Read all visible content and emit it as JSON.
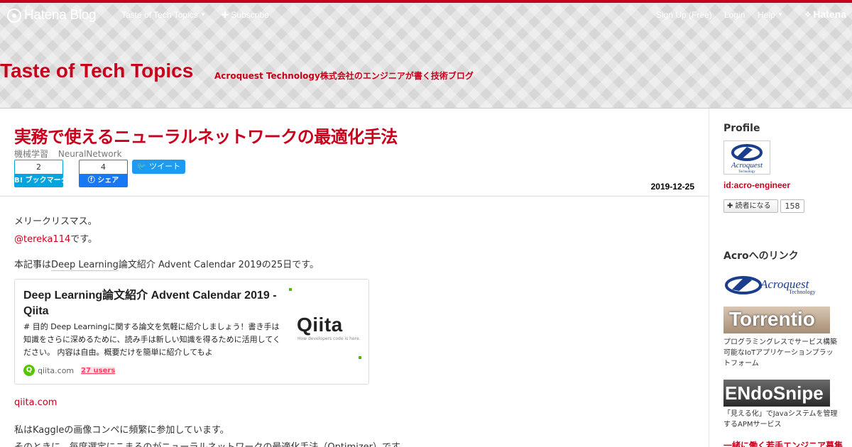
{
  "globalbar": {
    "logo_text": "Hatena Blog",
    "blog_menu": "Taste of Tech Topics",
    "subscribe": "Subscribe",
    "signup": "Sign Up (Free)",
    "login": "Login",
    "help": "Help",
    "brand": "Hatena"
  },
  "blog": {
    "title": "Taste of Tech Topics",
    "description": "Acroquest Technology株式会社のエンジニアが書く技術ブログ"
  },
  "entry": {
    "title": "実務で使えるニューラルネットワークの最適化手法",
    "categories": [
      "機械学習",
      "NeuralNetwork"
    ],
    "bookmark_count": "2",
    "bookmark_label": "ブックマーク",
    "facebook_count": "4",
    "facebook_label": "シェア",
    "tweet_label": "ツイート",
    "date": "2019-12-25",
    "lines": {
      "greeting": "メリークリスマス。",
      "author_link": "@tereka114",
      "author_suffix": "です。",
      "intro_prefix": "本記事は",
      "intro_keyword": "Deep Learning",
      "intro_suffix": "論文紹介 Advent Calendar 2019の25日です。",
      "source_link": "qiita.com",
      "kaggle": "私はKaggleの画像コンペに頻繁に参加しています。",
      "optimizer": "そのときに、毎度選定にこまるのがニューラルネットワークの最適化手法（Optimizer）です。"
    },
    "embed": {
      "title": "Deep Learning論文紹介 Advent Calendar 2019 - Qiita",
      "description": "# 目的 Deep Learningに関する論文を気軽に紹介しましょう！書き手は知識をさらに深めるために、読み手は新しい知識を得るために活用してください。 内容は自由。概要だけを簡単に紹介してもよ",
      "thumb_word": "Qiita",
      "thumb_tagline": "How developers code is here.",
      "domain": "qiita.com",
      "users": "27 users"
    }
  },
  "sidebar": {
    "profile_heading": "Profile",
    "profile_id": "id:acro-engineer",
    "reader_button": "読者になる",
    "reader_count": "158",
    "links_heading": "Acroへのリンク",
    "acro_logo_text": "Acroquest",
    "acro_logo_sub": "Technology",
    "torrentio": "Torrentio",
    "torrentio_caption": "プログラミングレスでサービス構築可能なIoTアプリケーションプラットフォーム",
    "endosnipe": "ENdoSnipe",
    "endosnipe_caption": "「見える化」でJavaシステムを管理するAPMサービス",
    "recruit_link": "一緒に働く若手エンジニア募集"
  },
  "colors": {
    "accent": "#c9001b",
    "topband": "#c4001b",
    "qiita_green": "#55c500",
    "hatena_blue": "#00a4de",
    "facebook_blue": "#1877f2",
    "twitter_blue": "#1d9bf0"
  }
}
